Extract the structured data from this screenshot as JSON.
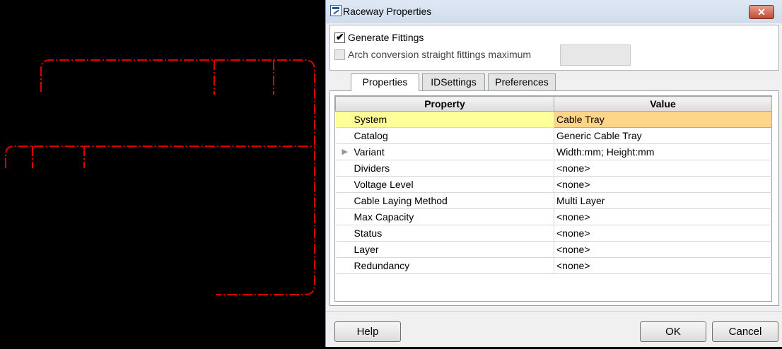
{
  "dialog": {
    "title": "Raceway Properties",
    "close_glyph": "✕",
    "options": {
      "generate_fittings_label": "Generate Fittings",
      "generate_fittings_checked": true,
      "arch_conversion_label": "Arch conversion straight fittings maximum",
      "arch_conversion_checked": false,
      "arch_conversion_value": ""
    },
    "tabs": [
      {
        "label": "Properties",
        "active": true
      },
      {
        "label": "IDSettings",
        "active": false
      },
      {
        "label": "Preferences",
        "active": false
      }
    ],
    "grid": {
      "headers": {
        "property": "Property",
        "value": "Value"
      },
      "rows": [
        {
          "property": "System",
          "value": "Cable Tray",
          "selected": true
        },
        {
          "property": "Catalog",
          "value": "Generic Cable Tray"
        },
        {
          "property": "Variant",
          "value": "Width:mm; Height:mm",
          "expandable": true
        },
        {
          "property": "Dividers",
          "value": "<none>"
        },
        {
          "property": "Voltage Level",
          "value": "<none>"
        },
        {
          "property": "Cable Laying Method",
          "value": "Multi Layer"
        },
        {
          "property": "Max Capacity",
          "value": "<none>"
        },
        {
          "property": "Status",
          "value": "<none>"
        },
        {
          "property": "Layer",
          "value": "<none>"
        },
        {
          "property": "Redundancy",
          "value": "<none>"
        }
      ]
    },
    "buttons": {
      "help": "Help",
      "ok": "OK",
      "cancel": "Cancel"
    }
  },
  "canvas": {
    "background": "#000000",
    "line_color": "#e00000"
  },
  "colors": {
    "selected_property_bg": "#ffff99",
    "selected_value_bg": "#ffd58a"
  }
}
